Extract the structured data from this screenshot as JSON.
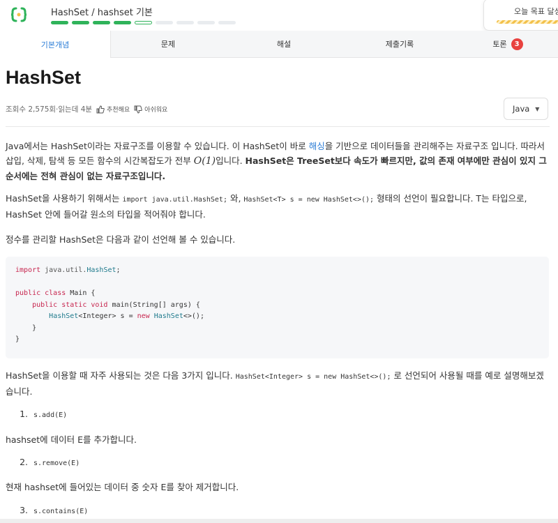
{
  "header": {
    "breadcrumb": "HashSet / hashset 기본",
    "progress": {
      "total": 9,
      "completed": 4,
      "current_index": 4
    },
    "goal_label": "오늘 목표 달성"
  },
  "tabs": [
    {
      "label": "기본개념",
      "active": true
    },
    {
      "label": "문제"
    },
    {
      "label": "해설"
    },
    {
      "label": "제출기록"
    },
    {
      "label": "토론",
      "badge": "3"
    }
  ],
  "article": {
    "title": "HashSet",
    "views": "조회수 2,575회",
    "read_time": "·읽는데 4분",
    "like_label": "추천해요",
    "dislike_label": "아쉬워요",
    "language": "Java"
  },
  "content": {
    "p1": {
      "a": "Java에서는 HashSet이라는 자료구조를 이용할 수 있습니다. 이 HashSet이 바로 ",
      "link": "해싱",
      "b": "을 기반으로 데이터들을 관리해주는 자료구조 입니다. 따라서 삽입, 삭제, 탐색 등 모든 함수의 시간복잡도가 전부 ",
      "math": "O(1)",
      "c": "입니다. ",
      "bold": "HashSet은 TreeSet보다 속도가 빠르지만, 값의 존재 여부에만 관심이 있지 그 순서에는 전혀 관심이 없는 자료구조입니다."
    },
    "p2": {
      "a": "HashSet을 사용하기 위해서는 ",
      "code1": "import java.util.HashSet;",
      "b": " 와, ",
      "code2": "HashSet<T> s = new HashSet<>();",
      "c": " 형태의 선언이 필요합니다. T는 타입으로, HashSet 안에 들어갈 원소의 타입을 적어줘야 합니다."
    },
    "p3": "정수를 관리할 HashSet은 다음과 같이 선언해 볼 수 있습니다.",
    "code_lines": [
      [
        "import",
        " java.util.",
        "HashSet",
        ";"
      ],
      [],
      [
        "public class",
        " Main {"
      ],
      [
        "    public static void",
        " main(String[] args) {"
      ],
      [
        "        ",
        "HashSet",
        "<Integer> s = ",
        "new",
        " ",
        "HashSet",
        "<>();"
      ],
      [
        "    }"
      ],
      [
        "}"
      ]
    ],
    "p4": {
      "a": "HashSet을 이용할 때 자주 사용되는 것은 다음 3가지 입니다. ",
      "code": "HashSet<Integer> s = new HashSet<>();",
      "b": " 로 선언되어 사용될 때를 예로 설명해보겠습니다."
    },
    "items": [
      {
        "num": "1.",
        "code": "s.add(E)",
        "desc": "hashset에 데이터 E를 추가합니다."
      },
      {
        "num": "2.",
        "code": "s.remove(E)",
        "desc": "현재 hashset에 들어있는 데이터 중 숫자 E를 찾아 제거합니다."
      },
      {
        "num": "3.",
        "code": "s.contains(E)"
      }
    ]
  },
  "colors": {
    "accent": "#2fb35a",
    "link": "#2a7cd6",
    "badge": "#e8423f",
    "keyword": "#c7254e"
  }
}
